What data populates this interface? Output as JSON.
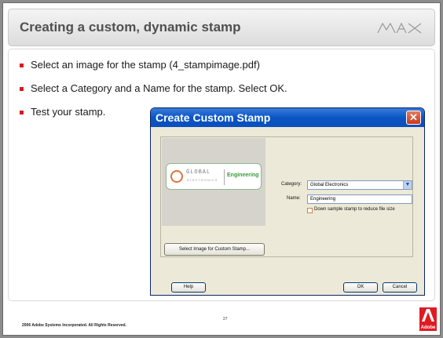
{
  "slide": {
    "title": "Creating a custom, dynamic stamp",
    "bullets": [
      "Select an image for the stamp (4_stampimage.pdf)",
      "Select a Category and a Name for the stamp. Select OK.",
      "Test your stamp."
    ],
    "footer_copyright": "2006 Adobe Systems Incorporated.  All Rights Reserved.",
    "page_number": "27",
    "brand_logo": "MAX",
    "adobe_logo_text": "Adobe"
  },
  "dialog": {
    "title": "Create Custom Stamp",
    "stamp_preview": {
      "brand": "GLOBAL",
      "sub": "ELECTRONICS",
      "label": "Engineering"
    },
    "select_image_button": "Select Image for Custom Stamp...",
    "category_label": "Category:",
    "category_value": "Global Electronics",
    "name_label": "Name:",
    "name_value": "Engineering",
    "downsample_label": "Down sample stamp to reduce file size",
    "help_button": "Help",
    "ok_button": "OK",
    "cancel_button": "Cancel"
  },
  "colors": {
    "bullet": "#d71920",
    "titlebar_blue": "#0b55c4",
    "stamp_green": "#3a9a3a"
  }
}
